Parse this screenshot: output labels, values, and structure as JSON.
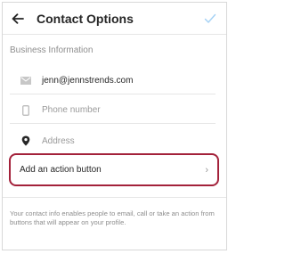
{
  "header": {
    "title": "Contact Options",
    "back_icon": "back-arrow-icon",
    "confirm_icon": "checkmark-icon",
    "accent_color": "#a7d3f5"
  },
  "business_info": {
    "section_title": "Business Information",
    "email": {
      "icon": "mail-icon",
      "value": "jenn@jennstrends.com"
    },
    "phone": {
      "icon": "phone-icon",
      "placeholder": "Phone number"
    },
    "address": {
      "icon": "location-pin-icon",
      "placeholder": "Address"
    }
  },
  "action_button": {
    "label": "Add an action button",
    "chevron": "›",
    "highlight_color": "#a3213a"
  },
  "footer": {
    "text": "Your contact info enables people to email, call or take an action from buttons that will appear on your profile."
  }
}
